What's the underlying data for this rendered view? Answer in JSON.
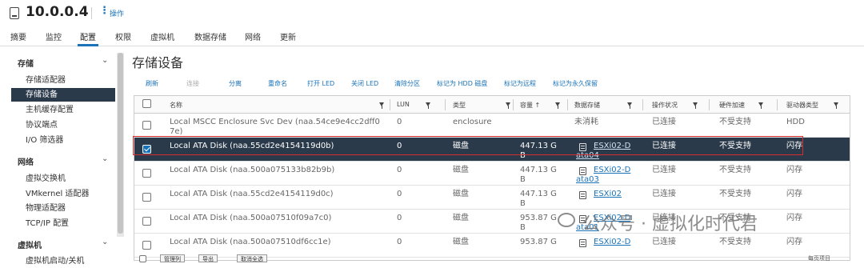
{
  "host": {
    "title": "10.0.0.4",
    "actions_label": "操作"
  },
  "tabs": [
    "摘要",
    "监控",
    "配置",
    "权限",
    "虚拟机",
    "数据存储",
    "网络",
    "更新"
  ],
  "sidebar": {
    "groups": [
      {
        "label": "存储",
        "items": [
          "存储适配器",
          "存储设备",
          "主机缓存配置",
          "协议端点",
          "I/O 筛选器"
        ]
      },
      {
        "label": "网络",
        "items": [
          "虚拟交换机",
          "VMkernel 适配器",
          "物理适配器",
          "TCP/IP 配置"
        ]
      },
      {
        "label": "虚拟机",
        "items": [
          "虚拟机启动/关机"
        ]
      }
    ]
  },
  "main": {
    "title": "存储设备",
    "toolbar": [
      "刷新",
      "连接",
      "分离",
      "重命名",
      "打开 LED",
      "关闭 LED",
      "清除分区",
      "标记为 HDD 磁盘",
      "标记为远程",
      "标记为永久保留"
    ],
    "columns": [
      "名称",
      "LUN",
      "类型",
      "容量 ↑",
      "数据存储",
      "操作状况",
      "硬件加速",
      "驱动器类型"
    ],
    "rows": [
      {
        "name": "Local MSCC Enclosure Svc Dev (naa.54ce9e4cc2dff0",
        "name2": "7e)",
        "lun": "0",
        "type": "enclosure",
        "capacity": "",
        "capacity2": "",
        "datastore": "未消耗",
        "datastore2": "",
        "status": "已连接",
        "accel": "不受支持",
        "drive": "HDD",
        "checked": false
      },
      {
        "name": "Local ATA Disk (naa.55cd2e4154119d0b)",
        "name2": "",
        "lun": "0",
        "type": "磁盘",
        "capacity": "447.13 G",
        "capacity2": "B",
        "datastore": "ESXi02-D",
        "datastore2": "ata04",
        "status": "已连接",
        "accel": "不受支持",
        "drive": "闪存",
        "checked": true
      },
      {
        "name": "Local ATA Disk (naa.500a075133b82b9b)",
        "name2": "",
        "lun": "0",
        "type": "磁盘",
        "capacity": "447.13 G",
        "capacity2": "B",
        "datastore": "ESXi02-D",
        "datastore2": "ata03",
        "status": "已连接",
        "accel": "不受支持",
        "drive": "闪存",
        "checked": false
      },
      {
        "name": "Local ATA Disk (naa.55cd2e4154119d0c)",
        "name2": "",
        "lun": "0",
        "type": "磁盘",
        "capacity": "447.13 G",
        "capacity2": "B",
        "datastore": "ESXi02",
        "datastore2": "",
        "status": "已连接",
        "accel": "不受支持",
        "drive": "闪存",
        "checked": false
      },
      {
        "name": "Local ATA Disk (naa.500a07510f09a7c0)",
        "name2": "",
        "lun": "0",
        "type": "磁盘",
        "capacity": "953.87 G",
        "capacity2": "B",
        "datastore": "ESXi02-D",
        "datastore2": "ata01",
        "status": "已连接",
        "accel": "不受支持",
        "drive": "闪存",
        "checked": false
      },
      {
        "name": "Local ATA Disk (naa.500a07510df6cc1e)",
        "name2": "",
        "lun": "0",
        "type": "磁盘",
        "capacity": "953.87 G",
        "capacity2": "",
        "datastore": "ESXi02-D",
        "datastore2": "",
        "status": "已连接",
        "accel": "不受支持",
        "drive": "闪存",
        "checked": false
      }
    ],
    "bottom_buttons": [
      "管理列",
      "导出",
      "取消全选"
    ],
    "bottom_right": "每页项目"
  },
  "watermark": "公众号 · 虚拟化时代君",
  "colors": {
    "accent": "#1a73b8",
    "selected_row": "#2b3a4a",
    "highlight": "#d62e2e"
  }
}
